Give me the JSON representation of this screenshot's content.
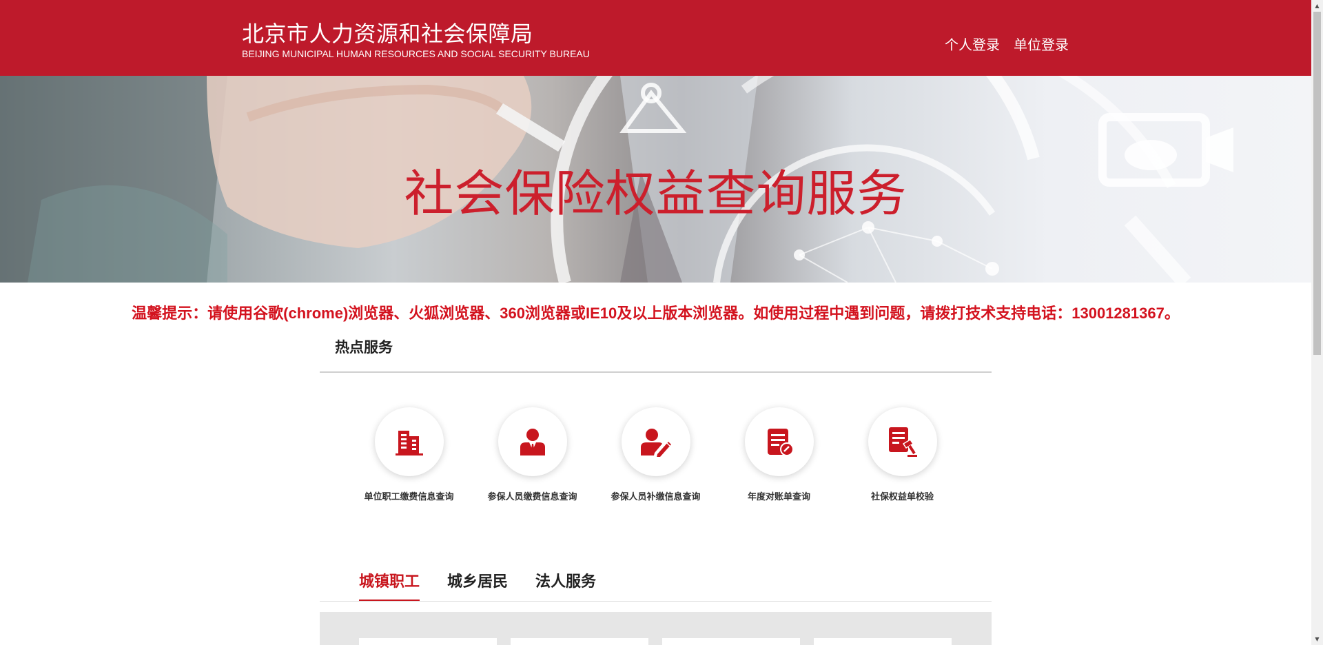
{
  "header": {
    "title_cn": "北京市人力资源和社会保障局",
    "title_en": "BEIJING MUNICIPAL HUMAN RESOURCES AND SOCIAL SECURITY BUREAU",
    "personal_login": "个人登录",
    "unit_login": "单位登录"
  },
  "banner": {
    "title": "社会保险权益查询服务"
  },
  "notice": "温馨提示：请使用谷歌(chrome)浏览器、火狐浏览器、360浏览器或IE10及以上版本浏览器。如使用过程中遇到问题，请拨打技术支持电话：13001281367。",
  "hot_services": {
    "title": "热点服务",
    "items": [
      {
        "label": "单位职工缴费信息查询",
        "icon": "building-icon"
      },
      {
        "label": "参保人员缴费信息查询",
        "icon": "person-suit-icon"
      },
      {
        "label": "参保人员补缴信息查询",
        "icon": "person-pen-icon"
      },
      {
        "label": "年度对账单查询",
        "icon": "document-check-icon"
      },
      {
        "label": "社保权益单校验",
        "icon": "document-gavel-icon"
      }
    ]
  },
  "tabs": [
    {
      "label": "城镇职工",
      "active": true
    },
    {
      "label": "城乡居民",
      "active": false
    },
    {
      "label": "法人服务",
      "active": false
    }
  ],
  "colors": {
    "brand_red": "#be1a2b",
    "accent_red": "#c8161e",
    "notice_red": "#d3121e"
  }
}
